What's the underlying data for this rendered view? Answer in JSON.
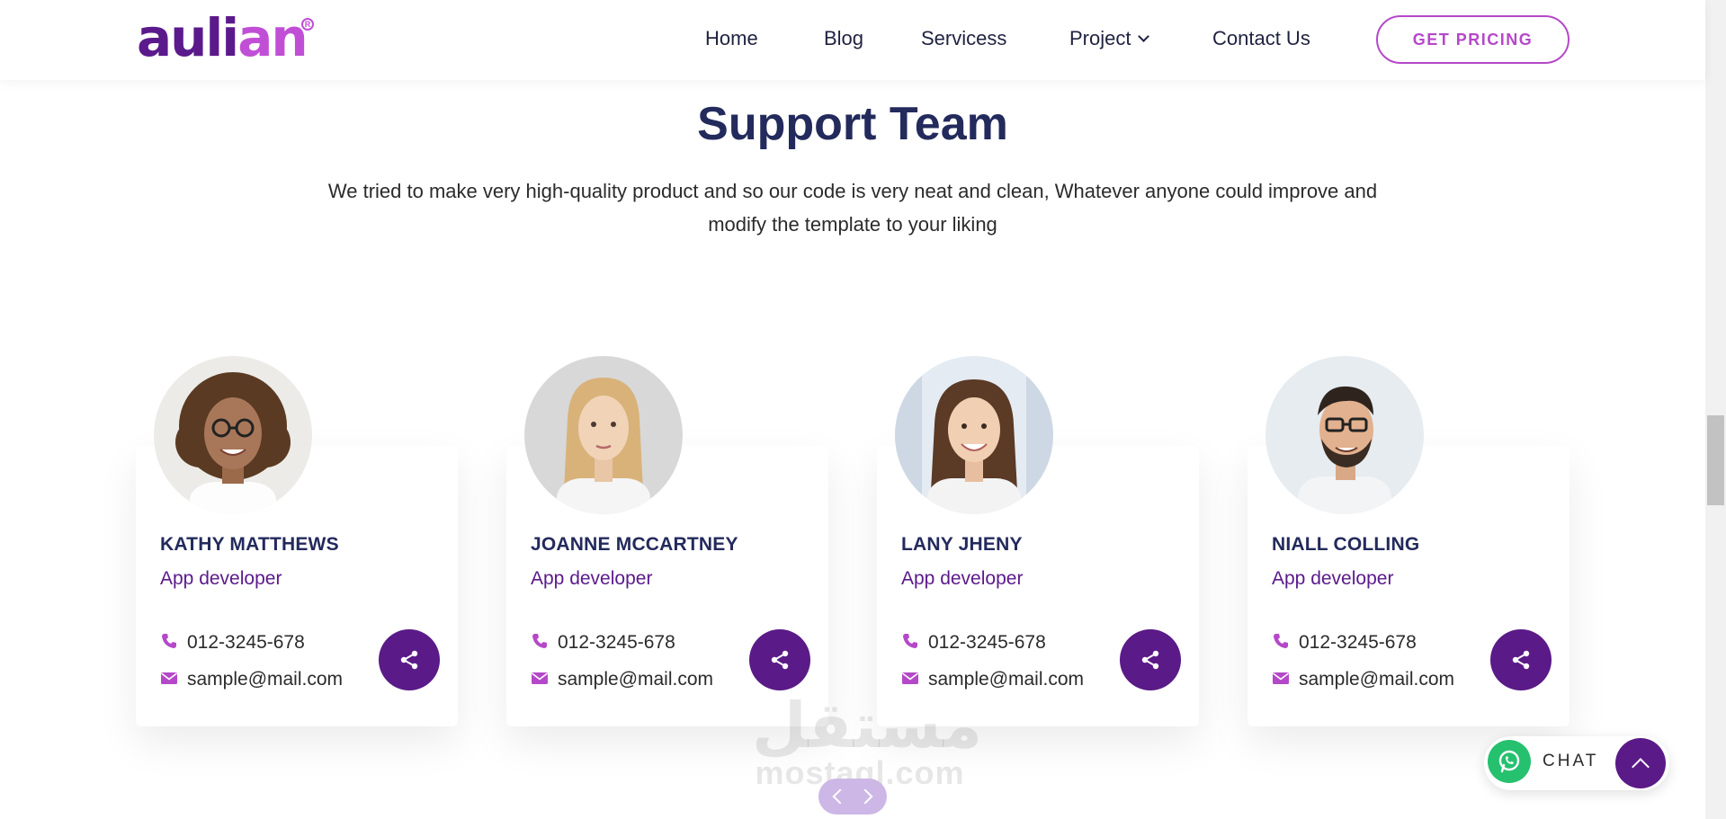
{
  "header": {
    "logo_part1": "auli",
    "logo_part2": "an",
    "nav": [
      {
        "label": "Home"
      },
      {
        "label": "Blog"
      },
      {
        "label": "Servicess"
      },
      {
        "label": "Project"
      },
      {
        "label": "Contact Us"
      }
    ],
    "cta_label": "GET PRICING"
  },
  "section": {
    "title": "Support Team",
    "description": "We tried to make very high-quality product and so our code is very neat and clean, Whatever anyone could improve and modify the template to your liking"
  },
  "team": [
    {
      "name": "KATHY MATTHEWS",
      "role": "App developer",
      "phone": "012-3245-678",
      "email": "sample@mail.com"
    },
    {
      "name": "JOANNE MCCARTNEY",
      "role": "App developer",
      "phone": "012-3245-678",
      "email": "sample@mail.com"
    },
    {
      "name": "LANY JHENY",
      "role": "App developer",
      "phone": "012-3245-678",
      "email": "sample@mail.com"
    },
    {
      "name": "NIALL COLLING",
      "role": "App developer",
      "phone": "012-3245-678",
      "email": "sample@mail.com"
    }
  ],
  "chat": {
    "label": "CHAT"
  },
  "watermark": {
    "arabic": "مستقل",
    "latin": "mostaql.com"
  },
  "icons": {
    "phone": "phone-icon",
    "email": "envelope-icon",
    "share": "share-icon",
    "whatsapp": "whatsapp-icon",
    "back_to_top": "chevron-up-icon"
  },
  "colors": {
    "brand_dark": "#5a1a87",
    "brand_light": "#b548c9",
    "heading": "#232a5c",
    "whatsapp": "#25c16f"
  }
}
